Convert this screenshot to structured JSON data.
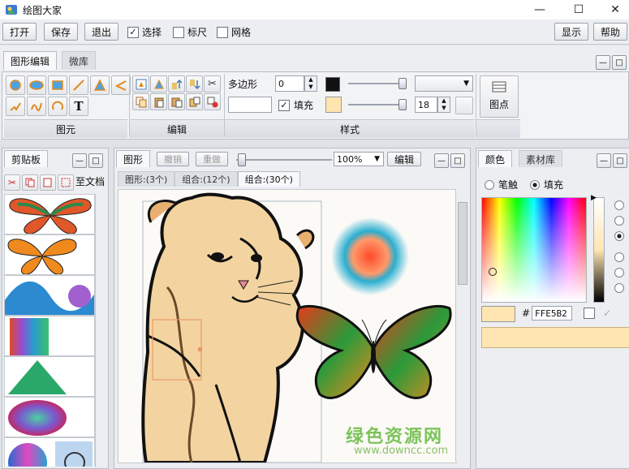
{
  "window": {
    "title": "绘图大家",
    "min_glyph": "—",
    "max_glyph": "☐",
    "close_glyph": "✕"
  },
  "menubar": {
    "open": "打开",
    "save": "保存",
    "exit": "退出",
    "select": "选择",
    "select_checked": true,
    "ruler": "标尺",
    "ruler_checked": false,
    "grid": "网格",
    "grid_checked": false,
    "show": "显示",
    "help": "帮助"
  },
  "ribbon": {
    "tabs": [
      "图形编辑",
      "微库"
    ],
    "groups": {
      "elements": "图元",
      "edit": "编辑",
      "style": "样式"
    },
    "shape_type": "多边形",
    "line_width": "0",
    "fill_label": "填充",
    "fill_checked": true,
    "size_value": "18",
    "point_button": "图点"
  },
  "clipboard": {
    "title": "剪贴板",
    "to_doc": "至文档"
  },
  "canvas": {
    "tab": "图形",
    "undo": "撤销",
    "redo": "重做",
    "zoom": "100%",
    "edit": "编辑",
    "subtabs": [
      "图形:(3个)",
      "组合:(12个)",
      "组合:(30个)"
    ]
  },
  "color_panel": {
    "tabs": [
      "颜色",
      "素材库"
    ],
    "stroke": "笔触",
    "fill": "填充",
    "fill_selected": true,
    "hex_label": "#",
    "hex_value": "FFE5B2",
    "current_color": "#FFE5B2"
  },
  "watermark": {
    "brand": "绿色资源网",
    "url": "www.downcc.com"
  },
  "colors": {
    "accent": "#3a7bd5",
    "selection": "#FFE5B2",
    "red": "#cc2222"
  }
}
